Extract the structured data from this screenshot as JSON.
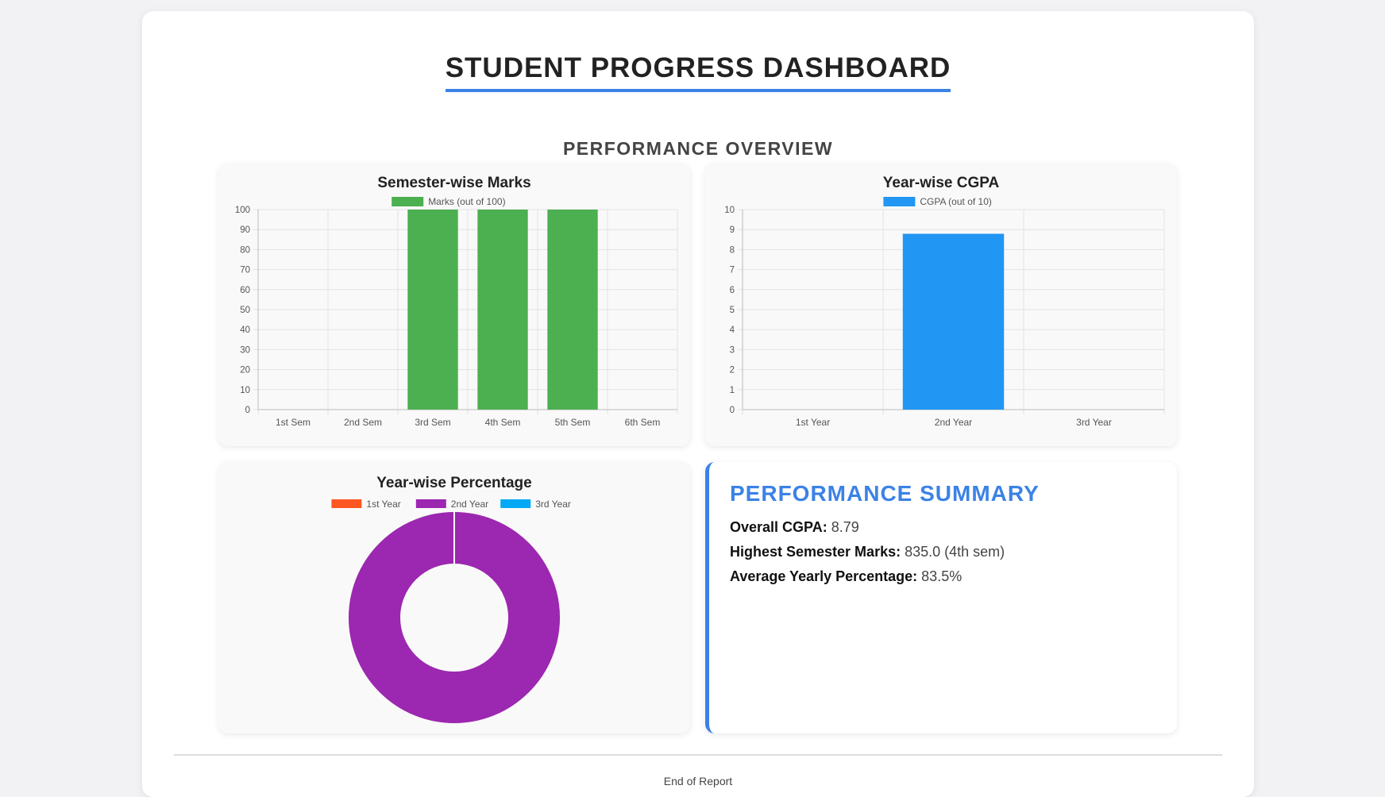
{
  "page": {
    "title": "STUDENT PROGRESS DASHBOARD",
    "section_title": "PERFORMANCE OVERVIEW",
    "footer": "End of Report"
  },
  "chart_data": [
    {
      "id": "marks",
      "type": "bar",
      "title": "Semester-wise Marks",
      "categories": [
        "1st Sem",
        "2nd Sem",
        "3rd Sem",
        "4th Sem",
        "5th Sem",
        "6th Sem"
      ],
      "series": [
        {
          "name": "Marks (out of 100)",
          "values": [
            0,
            0,
            100,
            100,
            100,
            0
          ],
          "color": "#4caf50"
        }
      ],
      "ylim": [
        0,
        100
      ],
      "yticks": [
        0,
        10,
        20,
        30,
        40,
        50,
        60,
        70,
        80,
        90,
        100
      ],
      "grid": true,
      "legend": "top"
    },
    {
      "id": "cgpa",
      "type": "bar",
      "title": "Year-wise CGPA",
      "categories": [
        "1st Year",
        "2nd Year",
        "3rd Year"
      ],
      "series": [
        {
          "name": "CGPA (out of 10)",
          "values": [
            0,
            8.79,
            0
          ],
          "color": "#2196f3"
        }
      ],
      "ylim": [
        0,
        10
      ],
      "yticks": [
        0,
        1,
        2,
        3,
        4,
        5,
        6,
        7,
        8,
        9,
        10
      ],
      "grid": true,
      "legend": "top"
    },
    {
      "id": "pct",
      "type": "pie",
      "title": "Year-wise Percentage",
      "labels": [
        "1st Year",
        "2nd Year",
        "3rd Year"
      ],
      "values": [
        0,
        83.5,
        0
      ],
      "colors": [
        "#ff5722",
        "#9c27b0",
        "#03a9f4"
      ],
      "legend": "top"
    }
  ],
  "summary": {
    "title": "PERFORMANCE SUMMARY",
    "overall_cgpa_label": "Overall CGPA:",
    "overall_cgpa_value": "8.79",
    "highest_marks_label": "Highest Semester Marks:",
    "highest_marks_value": "835.0 (4th sem)",
    "avg_pct_label": "Average Yearly Percentage:",
    "avg_pct_value": "83.5%"
  }
}
